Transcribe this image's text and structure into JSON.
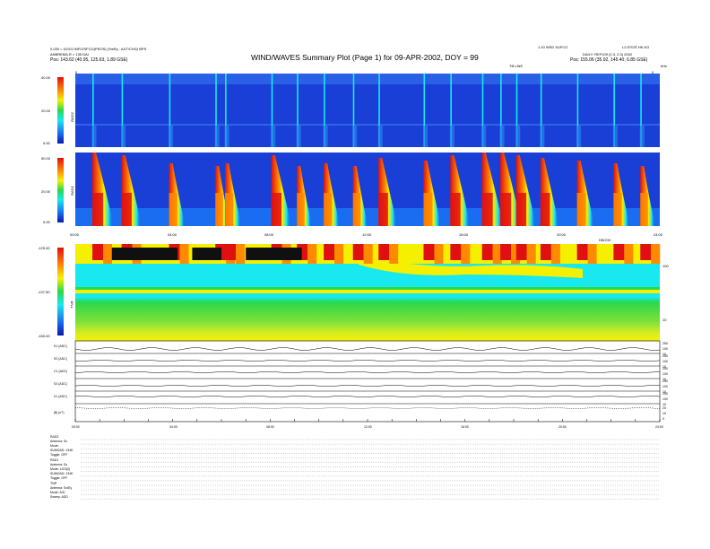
{
  "header": {
    "title": "WIND/WAVES Summary Plot (Page 1) for 09-APR-2002, DOY = 99",
    "left_line1": "0.030 = DOC0 INFO/SFCG(PE/0S) (%eRy - AXT/CHG) BPS",
    "left_line2": "ANBREMA.R = 135 DAI",
    "left_line3": "Pos:   143.62 (40.95, 125.63, 1.89 GSE)",
    "right_line1": "1.10 WSD SUFCO",
    "right_line1b": "L2.5T03T.HK.KO",
    "right_line2": "DAILY: REF109 (2.3, 2.3) 2002",
    "right_line3": "Pos:   155.06 (35.92, 145.40, 6.85 GSE)",
    "tb_label": "TB LINE",
    "tb_left": "0",
    "tb_right": "0",
    "units_kHz": "kHz"
  },
  "chart_data": [
    {
      "type": "heatmap",
      "panel": "RAD2",
      "ylabel": "RAD2",
      "colorbar_ticks": [
        "40.00",
        "20.00",
        "0.00"
      ],
      "x_ticks": [
        "00:00",
        "04:00",
        "08:00",
        "12:00",
        "16:00",
        "20:00",
        "24:00"
      ],
      "bursts_hours": [
        0.7,
        1.9,
        3.85,
        5.75,
        6.15,
        8.05,
        9.1,
        10.2,
        11.4,
        12.45,
        14.3,
        15.4,
        16.7,
        17.45,
        18.1,
        19.1,
        20.6,
        22.1,
        23.2
      ]
    },
    {
      "type": "heatmap",
      "panel": "RAD1",
      "ylabel": "RAD1",
      "colorbar_ticks": [
        "50.00",
        "20.00",
        "0.00"
      ],
      "bursts_hours": [
        0.7,
        1.9,
        3.85,
        5.75,
        6.15,
        8.05,
        9.1,
        10.2,
        11.4,
        12.45,
        14.3,
        15.4,
        16.7,
        17.45,
        18.1,
        19.1,
        20.6,
        22.1,
        23.2
      ]
    },
    {
      "type": "heatmap",
      "panel": "TNR",
      "ylabel": "TNR",
      "x_label": "DB/CM",
      "colorbar_ticks": [
        "-125.00",
        "-137.50",
        "-150.00"
      ],
      "right_ticks": [
        "100",
        "10"
      ]
    },
    {
      "type": "line",
      "panel": "time-series",
      "series": [
        {
          "name": "S1 (ADC)",
          "right_ticks": [
            "250",
            "100",
            "10"
          ]
        },
        {
          "name": "S2 (ADC)",
          "right_ticks": [
            "250",
            "100",
            "10"
          ]
        },
        {
          "name": "C1 (ADC)",
          "right_ticks": [
            "250",
            "100",
            "10"
          ]
        },
        {
          "name": "S3 (ADC)",
          "right_ticks": [
            "250",
            "100",
            "10"
          ]
        },
        {
          "name": "X1 (ADC)",
          "right_ticks": [
            "250",
            "100",
            "10"
          ]
        },
        {
          "name": "|B| (nT)",
          "right_ticks": [
            "20",
            "10",
            "0"
          ]
        }
      ],
      "x_ticks": [
        "00:00",
        "04:00",
        "08:00",
        "12:00",
        "16:00",
        "20:00",
        "24:00"
      ]
    }
  ],
  "status_lines": [
    "RAD2",
    "Antenna:    Sx",
    "Mode:      ",
    "SUMOAD: 134K",
    "Toggle:      OFF",
    "RAD1",
    "Antenna:    Sx",
    "Mode:   LOG(ll)",
    "SUMOAD: 134K",
    "Toggle:      OFF",
    "TNR",
    "Antenna:    Sx/Ey",
    "Mode:      A/D",
    "Sweep:      ADD"
  ],
  "colors": {
    "background_blue": "#1a3fd6",
    "deep_blue": "#0a1aa8",
    "red": "#e01010",
    "orange": "#ff8a00",
    "yellow": "#f5f000",
    "cyan": "#18e8f0",
    "green": "#2ad84a"
  }
}
